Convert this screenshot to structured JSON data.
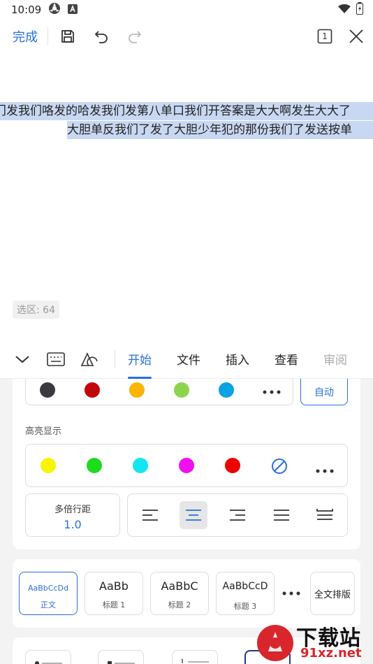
{
  "status_bar": {
    "time": "10:09"
  },
  "toolbar": {
    "done_label": "完成",
    "page_indicator": "1"
  },
  "document": {
    "line1": "门发我们咯发的哈发我们发第八单口我们开答案是大大啊发生大大了",
    "line2": "大胆单反我们了发了大胆少年犯的那份我们了发送按单",
    "selection_label": "选区: 64"
  },
  "panel_tabs": [
    "开始",
    "文件",
    "插入",
    "查看",
    "审阅"
  ],
  "active_tab": "开始",
  "font_colors": [
    "#3a3b3f",
    "#c0050b",
    "#fbb500",
    "#8bd54b",
    "#0aa2e3"
  ],
  "auto_label": "自动",
  "highlight": {
    "label": "高亮显示",
    "colors": [
      "#f6f600",
      "#1ddc1d",
      "#12e6f0",
      "#f00ff0",
      "#f00000"
    ]
  },
  "line_spacing": {
    "title": "多倍行距",
    "value": "1.0"
  },
  "alignment": {
    "selected": "center"
  },
  "styles": [
    {
      "sample": "AaBbCcDd",
      "label": "正文"
    },
    {
      "sample": "AaBb",
      "label": "标题 1"
    },
    {
      "sample": "AaBbC",
      "label": "标题 2"
    },
    {
      "sample": "AaBbCcD",
      "label": "标题 3"
    }
  ],
  "full_layout_label": "全文排版",
  "watermark": {
    "main": "下载站",
    "sub": "91xz.net"
  },
  "colors": {
    "accent": "#2a6fd6"
  }
}
